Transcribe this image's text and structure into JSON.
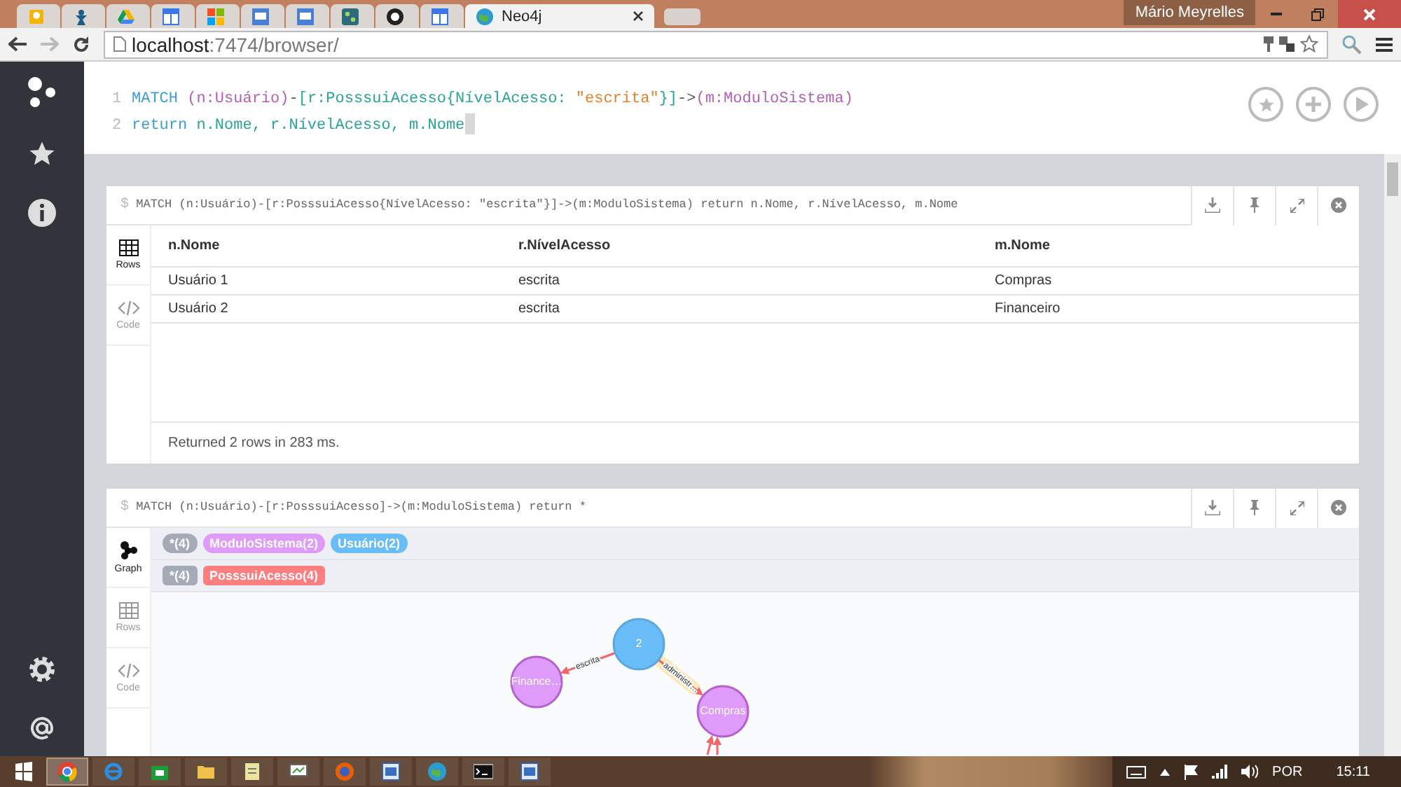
{
  "browser": {
    "tabs": [
      {
        "kind": "bulb",
        "selected": false
      },
      {
        "kind": "figure",
        "selected": false
      },
      {
        "kind": "drive",
        "selected": false
      },
      {
        "kind": "layout",
        "selected": false
      },
      {
        "kind": "squares",
        "selected": false
      },
      {
        "kind": "document",
        "selected": false
      },
      {
        "kind": "document",
        "selected": false
      },
      {
        "kind": "graph",
        "selected": false
      },
      {
        "kind": "github",
        "selected": false
      },
      {
        "kind": "layout",
        "selected": false
      },
      {
        "kind": "neo4j",
        "title": "Neo4j",
        "selected": true
      }
    ],
    "user": "Mário Meyrelles",
    "url_host": "localhost",
    "url_path": ":7474/browser/"
  },
  "editor": {
    "lines": [
      {
        "number": "1",
        "cursor": false,
        "tokens": [
          {
            "text": "MATCH ",
            "kind": "keyword"
          },
          {
            "text": "(n:Usuário)",
            "kind": "node"
          },
          {
            "text": "-",
            "kind": "plain"
          },
          {
            "text": "[r:PosssuiAcesso{NívelAcesso: ",
            "kind": "rel"
          },
          {
            "text": "\"escrita\"",
            "kind": "string"
          },
          {
            "text": "}]",
            "kind": "rel"
          },
          {
            "text": "->",
            "kind": "plain"
          },
          {
            "text": "(m:ModuloSistema)",
            "kind": "node"
          }
        ]
      },
      {
        "number": "2",
        "cursor": true,
        "tokens": [
          {
            "text": "return ",
            "kind": "keyword"
          },
          {
            "text": "n.Nome, r.NívelAcesso, m.Nome",
            "kind": "prop"
          }
        ]
      }
    ]
  },
  "cards": [
    {
      "kind": "table",
      "prompt": "$",
      "command": "MATCH (n:Usuário)-[r:PosssuiAcesso{NívelAcesso: \"escrita\"}]->(m:ModuloSistema) return n.Nome, r.NívelAcesso, m.Nome",
      "views": [
        {
          "label": "Rows",
          "kind": "rows",
          "selected": true
        },
        {
          "label": "Code",
          "kind": "code",
          "selected": false
        }
      ],
      "table": {
        "columns": [
          "n.Nome",
          "r.NívelAcesso",
          "m.Nome"
        ],
        "rows": [
          [
            "Usuário 1",
            "escrita",
            "Compras"
          ],
          [
            "Usuário 2",
            "escrita",
            "Financeiro"
          ]
        ]
      },
      "status": "Returned 2 rows in 283 ms."
    },
    {
      "kind": "graph",
      "prompt": "$",
      "command": "MATCH (n:Usuário)-[r:PosssuiAcesso]->(m:ModuloSistema) return *",
      "views": [
        {
          "label": "Graph",
          "kind": "graph",
          "selected": true
        },
        {
          "label": "Rows",
          "kind": "rows",
          "selected": false
        },
        {
          "label": "Code",
          "kind": "code",
          "selected": false
        }
      ],
      "legend": [
        [
          {
            "text": "*(4)",
            "color": "#a5abb6"
          },
          {
            "text": "ModuloSistema(2)",
            "color": "#de9bf9"
          },
          {
            "text": "Usuário(2)",
            "color": "#68bdf6"
          }
        ],
        [
          {
            "text": "*(4)",
            "color": "#a5abb6"
          },
          {
            "text": "PosssuiAcesso(4)",
            "color": "#fb7e81"
          }
        ]
      ],
      "graph": {
        "nodes": [
          {
            "label": "2",
            "color": "#68bdf6"
          },
          {
            "label": "Finance…",
            "color": "#de9bf9"
          },
          {
            "label": "Compras",
            "color": "#de9bf9"
          }
        ],
        "relationships": [
          {
            "label": "escrita",
            "selected": false
          },
          {
            "label": "administr…",
            "selected": true
          }
        ]
      }
    }
  ],
  "taskbar": {
    "items": [
      {
        "kind": "chrome",
        "selected": true
      },
      {
        "kind": "ie",
        "selected": false
      },
      {
        "kind": "store",
        "selected": false
      },
      {
        "kind": "folder",
        "selected": false
      },
      {
        "kind": "notepad",
        "selected": false
      },
      {
        "kind": "monitor",
        "selected": false
      },
      {
        "kind": "firefox",
        "selected": false
      },
      {
        "kind": "app",
        "selected": false
      },
      {
        "kind": "globe",
        "selected": false
      },
      {
        "kind": "console",
        "selected": false
      },
      {
        "kind": "app",
        "selected": false
      }
    ],
    "language": "POR",
    "time": "15:11"
  }
}
